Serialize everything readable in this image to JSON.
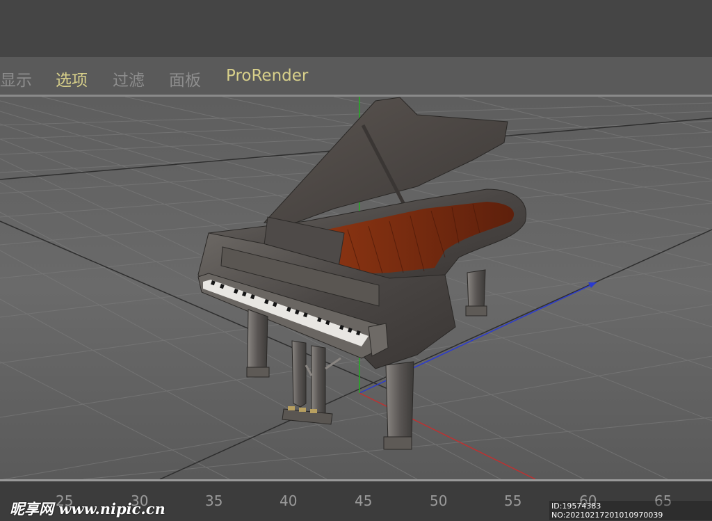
{
  "menu": {
    "items": [
      {
        "label": "显示"
      },
      {
        "label": "选项"
      },
      {
        "label": "过滤"
      },
      {
        "label": "面板"
      },
      {
        "label": "ProRender"
      }
    ]
  },
  "timeline": {
    "ticks": [
      "25",
      "30",
      "35",
      "40",
      "45",
      "50",
      "55",
      "60",
      "65"
    ]
  },
  "watermark": {
    "site": "昵享网 www.nipic.cn",
    "id_text": "ID:19574383 NO:20210217201010970039"
  },
  "colors": {
    "active_menu": "#d8d08a",
    "inactive_menu": "#8d8d8d",
    "axis_x": "#c03030",
    "axis_y": "#20b020",
    "axis_z": "#2a3ad0",
    "piano_body": "#4a4846",
    "piano_interior": "#7a2a10"
  }
}
